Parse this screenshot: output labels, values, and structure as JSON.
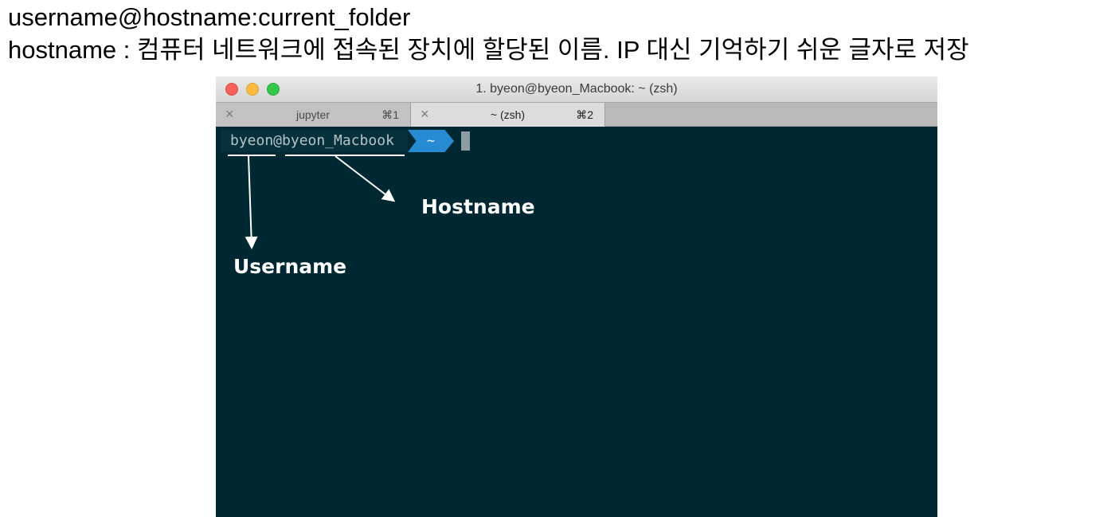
{
  "header": {
    "line1": "username@hostname:current_folder",
    "line2": "hostname : 컴퓨터 네트워크에 접속된 장치에 할당된 이름. IP 대신 기억하기 쉬운 글자로 저장"
  },
  "window": {
    "title": "1. byeon@byeon_Macbook: ~ (zsh)",
    "tabs": [
      {
        "label": "jupyter",
        "shortcut": "⌘1",
        "close": "×"
      },
      {
        "label": "~ (zsh)",
        "shortcut": "⌘2",
        "close": "×"
      }
    ]
  },
  "terminal": {
    "prompt_user_host": "byeon@byeon_Macbook",
    "prompt_dir": "~"
  },
  "annotations": {
    "hostname": "Hostname",
    "username": "Username"
  },
  "colors": {
    "terminal_bg": "#002833",
    "prompt_dir_bg": "#268bd2",
    "annotation": "#ffffff"
  }
}
